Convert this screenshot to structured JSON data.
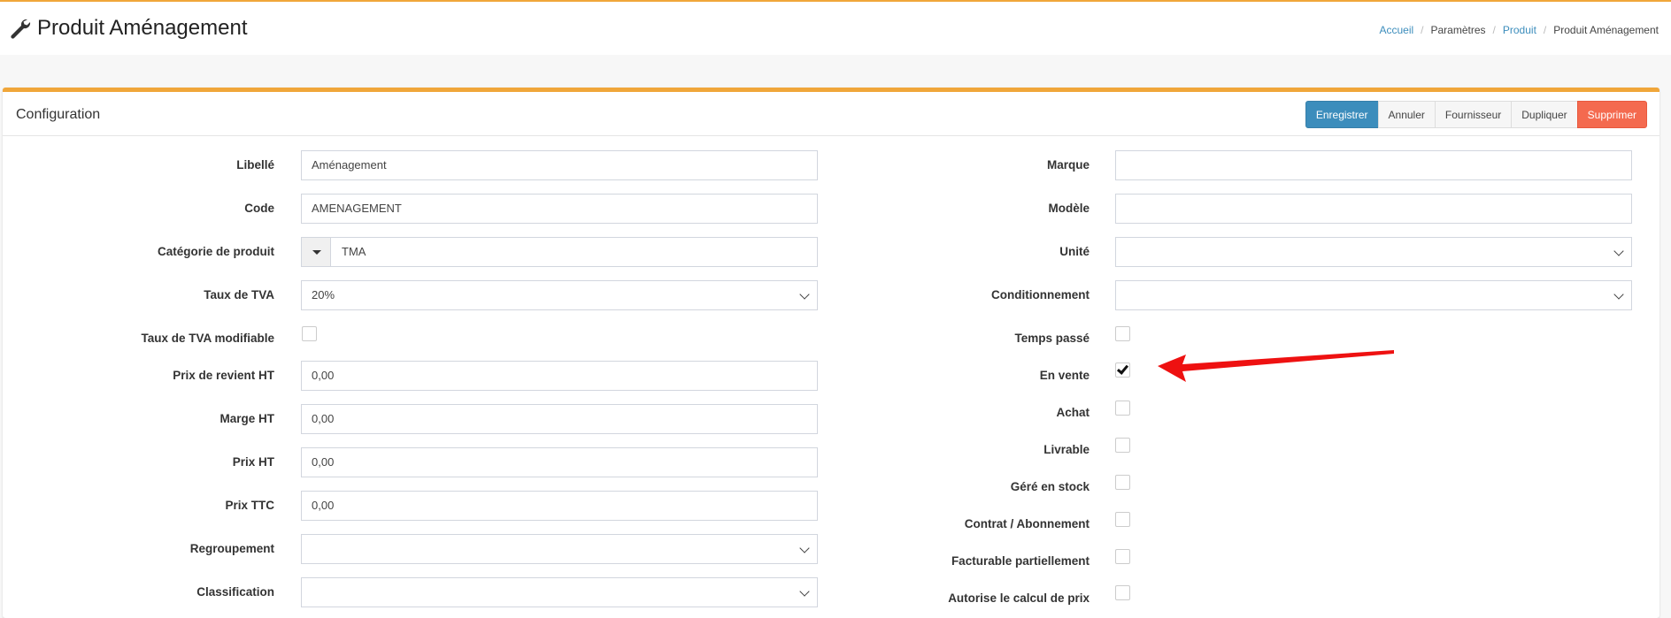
{
  "header": {
    "title": "Produit Aménagement",
    "breadcrumb": [
      "Accueil",
      "Paramètres",
      "Produit",
      "Produit Aménagement"
    ]
  },
  "box": {
    "title": "Configuration",
    "toolbar": {
      "save": "Enregistrer",
      "cancel": "Annuler",
      "supplier": "Fournisseur",
      "duplicate": "Dupliquer",
      "delete": "Supprimer"
    }
  },
  "left": {
    "libelle": {
      "label": "Libellé",
      "value": "Aménagement"
    },
    "code": {
      "label": "Code",
      "value": "AMENAGEMENT"
    },
    "categorie": {
      "label": "Catégorie de produit",
      "value": "TMA"
    },
    "tva": {
      "label": "Taux de TVA",
      "value": "20%"
    },
    "tva_modifiable": {
      "label": "Taux de TVA modifiable",
      "checked": false
    },
    "prix_revient": {
      "label": "Prix de revient HT",
      "value": "0,00"
    },
    "marge": {
      "label": "Marge HT",
      "value": "0,00"
    },
    "prix_ht": {
      "label": "Prix HT",
      "value": "0,00"
    },
    "prix_ttc": {
      "label": "Prix TTC",
      "value": "0,00"
    },
    "regroupement": {
      "label": "Regroupement",
      "value": ""
    },
    "classification": {
      "label": "Classification",
      "value": ""
    }
  },
  "right": {
    "marque": {
      "label": "Marque",
      "value": ""
    },
    "modele": {
      "label": "Modèle",
      "value": ""
    },
    "unite": {
      "label": "Unité",
      "value": ""
    },
    "conditionnement": {
      "label": "Conditionnement",
      "value": ""
    },
    "temps_passe": {
      "label": "Temps passé",
      "checked": false
    },
    "en_vente": {
      "label": "En vente",
      "checked": true
    },
    "achat": {
      "label": "Achat",
      "checked": false
    },
    "livrable": {
      "label": "Livrable",
      "checked": false
    },
    "gere_stock": {
      "label": "Géré en stock",
      "checked": false
    },
    "contrat": {
      "label": "Contrat / Abonnement",
      "checked": false
    },
    "facturable": {
      "label": "Facturable partiellement",
      "checked": false
    },
    "autorise": {
      "label": "Autorise le calcul de prix",
      "checked": false
    }
  },
  "colors": {
    "accent": "#f0a63a",
    "primary": "#3c8dbc",
    "danger": "#f46a4f",
    "annotation": "#ee1111"
  },
  "annotation": {
    "type": "arrow",
    "target": "En vente"
  }
}
